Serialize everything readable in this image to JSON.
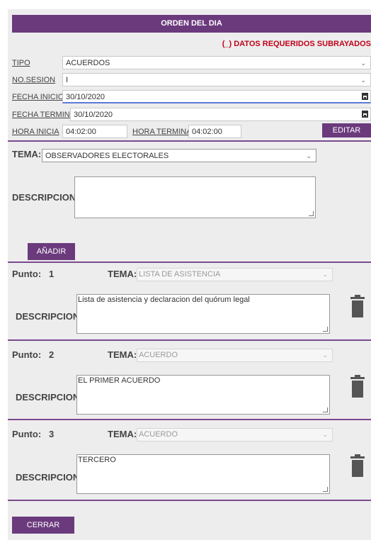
{
  "header": {
    "title": "ORDEN DEL DIA",
    "required_note": "(_) DATOS REQUERIDOS SUBRAYADOS"
  },
  "form": {
    "tipo_label": "TIPO",
    "tipo_value": "ACUERDOS",
    "sesion_label": "NO.SESION",
    "sesion_value": "I",
    "fecha_inicio_label": "FECHA INICIO:",
    "fecha_inicio_value": "30/10/2020",
    "fecha_termina_label": "FECHA TERMINA:",
    "fecha_termina_value": "30/10/2020",
    "hora_inicia_label": "HORA INICIA",
    "hora_inicia_value": "04:02:00",
    "hora_termina_label": "HORA TERMINA:",
    "hora_termina_value": "04:02:00",
    "editar_label": "EDITAR"
  },
  "new_item": {
    "tema_label": "TEMA:",
    "tema_value": "OBSERVADORES ELECTORALES",
    "descripcion_label": "DESCRIPCION:",
    "descripcion_value": "",
    "anadir_label": "AÑADIR"
  },
  "puntos": [
    {
      "label": "Punto:",
      "number": "1",
      "tema_label": "TEMA:",
      "tema_value": "LISTA DE ASISTENCIA",
      "descripcion_label": "DESCRIPCION:",
      "descripcion_value": "Lista de asistencia y declaracion del quórum legal"
    },
    {
      "label": "Punto:",
      "number": "2",
      "tema_label": "TEMA:",
      "tema_value": "ACUERDO",
      "descripcion_label": "DESCRIPCION:",
      "descripcion_value": "EL PRIMER ACUERDO"
    },
    {
      "label": "Punto:",
      "number": "3",
      "tema_label": "TEMA:",
      "tema_value": "ACUERDO",
      "descripcion_label": "DESCRIPCION:",
      "descripcion_value": "TERCERO"
    }
  ],
  "footer": {
    "cerrar_label": "CERRAR"
  },
  "colors": {
    "accent": "#6b3a7d",
    "required": "#c0001a",
    "panel": "#ededed"
  }
}
